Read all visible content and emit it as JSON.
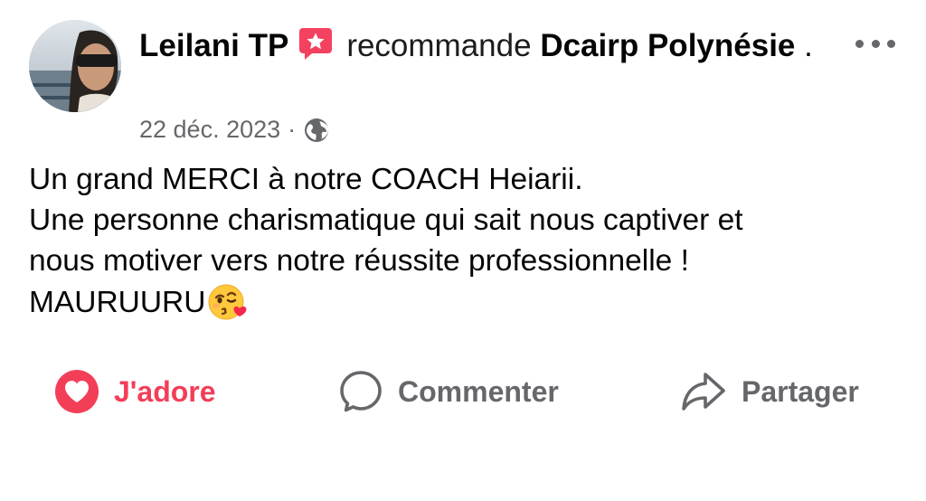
{
  "post": {
    "author": "Leilani TP",
    "verb": "recommande",
    "page_name": "Dcairp Polynésie",
    "trailing": ".",
    "date": "22 déc. 2023",
    "separator": "·",
    "privacy_icon": "globe-icon",
    "badge_icon": "recommendation-star-icon",
    "more_icon": "more-options-icon",
    "text_lines": [
      "Un grand MERCI à notre COACH Heiarii.",
      "Une personne charismatique qui sait nous captiver et",
      "nous motiver vers notre réussite professionnelle !",
      "MAURUURU"
    ],
    "emoji": "face-throwing-kiss-emoji"
  },
  "actions": {
    "like_label": "J'adore",
    "comment_label": "Commenter",
    "share_label": "Partager"
  },
  "colors": {
    "love": "#f33e58",
    "secondary_text": "#65676b",
    "badge": "#f3425f"
  }
}
